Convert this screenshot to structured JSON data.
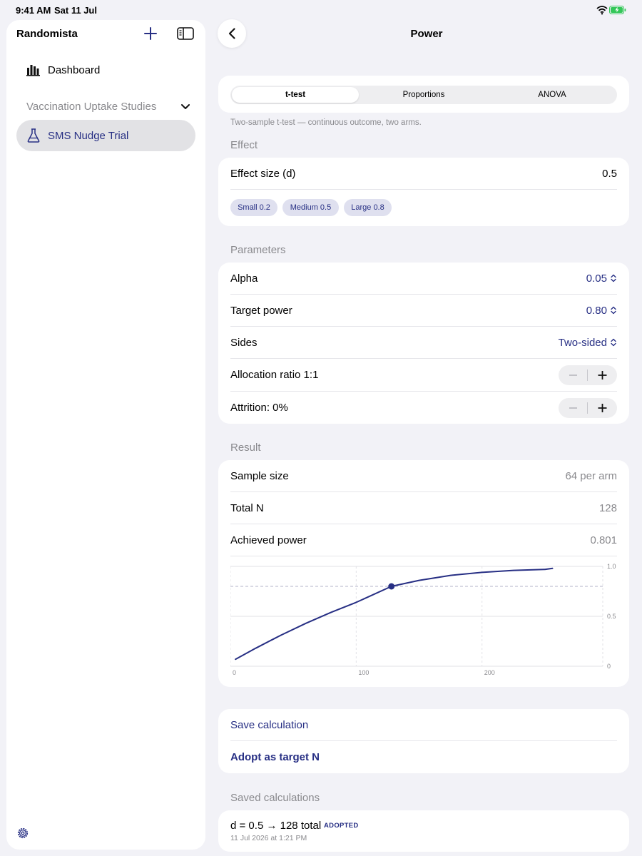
{
  "status": {
    "time": "9:41 AM",
    "date": "Sat 11 Jul"
  },
  "sidebar": {
    "title": "Randomista",
    "dashboard_label": "Dashboard",
    "group_label": "Vaccination Uptake Studies",
    "active_item_label": "SMS Nudge Trial"
  },
  "nav": {
    "title": "Power"
  },
  "tabs": {
    "items": [
      "t-test",
      "Proportions",
      "ANOVA"
    ],
    "selected": "t-test"
  },
  "caption": "Two-sample t-test — continuous outcome, two arms.",
  "effect": {
    "header": "Effect",
    "label": "Effect size (d)",
    "value": "0.5",
    "presets": [
      "Small 0.2",
      "Medium 0.5",
      "Large 0.8"
    ]
  },
  "parameters": {
    "header": "Parameters",
    "alpha_label": "Alpha",
    "alpha_value": "0.05",
    "power_label": "Target power",
    "power_value": "0.80",
    "sides_label": "Sides",
    "sides_value": "Two-sided",
    "allocation_label": "Allocation ratio 1:1",
    "attrition_label": "Attrition: 0%"
  },
  "result": {
    "header": "Result",
    "sample_label": "Sample size",
    "sample_value": "64 per arm",
    "total_label": "Total N",
    "total_value": "128",
    "achieved_label": "Achieved power",
    "achieved_value": "0.801"
  },
  "chart_data": {
    "type": "line",
    "title": "",
    "xlabel": "",
    "ylabel": "",
    "x_ticks": [
      "0",
      "100",
      "200"
    ],
    "y_ticks": [
      "0",
      "0.5",
      "1.0"
    ],
    "xlim": [
      0,
      296
    ],
    "ylim": [
      0,
      1
    ],
    "grid": true,
    "series": [
      {
        "x": [
          4,
          20,
          40,
          60,
          80,
          100,
          128,
          150,
          175,
          200,
          225,
          250,
          256
        ],
        "y": [
          0.07,
          0.18,
          0.31,
          0.43,
          0.54,
          0.64,
          0.8,
          0.86,
          0.91,
          0.94,
          0.96,
          0.97,
          0.98
        ]
      }
    ],
    "marker": {
      "x": 128,
      "y": 0.8
    },
    "reference_line_y": 0.8,
    "colors": {
      "line": "#272f84",
      "grid": "#e2e2e6",
      "reference": "#b3b3c8"
    }
  },
  "actions": {
    "save_label": "Save calculation",
    "adopt_label": "Adopt as target N"
  },
  "saved": {
    "header": "Saved calculations",
    "items": [
      {
        "title": "d = 0.5 → 128 total",
        "badge": "ADOPTED",
        "date": "11 Jul 2026 at 1:21 PM"
      }
    ]
  },
  "colors": {
    "accent": "#272f84",
    "background": "#f2f2f7",
    "chip_bg": "#dfe0ef"
  }
}
